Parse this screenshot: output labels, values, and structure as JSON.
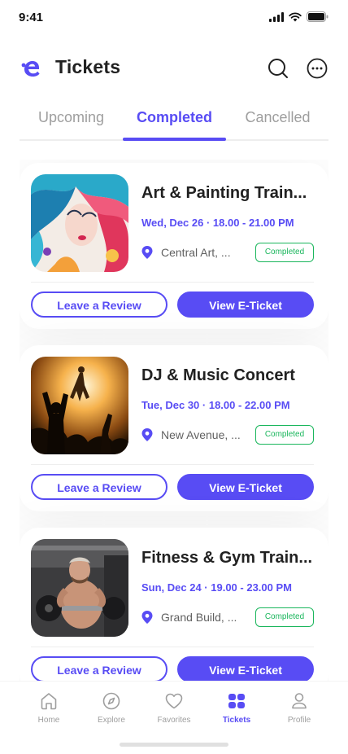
{
  "status_bar": {
    "time": "9:41"
  },
  "header": {
    "title": "Tickets"
  },
  "tabs": [
    {
      "label": "Upcoming",
      "active": false
    },
    {
      "label": "Completed",
      "active": true
    },
    {
      "label": "Cancelled",
      "active": false
    }
  ],
  "tickets": [
    {
      "title": "Art & Painting Train...",
      "date": "Wed, Dec 26 · 18.00 - 21.00 PM",
      "location": "Central Art, ...",
      "status": "Completed",
      "review_label": "Leave a Review",
      "ticket_label": "View E-Ticket",
      "image": "art-painting-image"
    },
    {
      "title": "DJ & Music Concert",
      "date": "Tue, Dec 30 · 18.00 - 22.00 PM",
      "location": "New Avenue, ...",
      "status": "Completed",
      "review_label": "Leave a Review",
      "ticket_label": "View E-Ticket",
      "image": "concert-image"
    },
    {
      "title": "Fitness & Gym Train...",
      "date": "Sun, Dec 24 · 19.00 - 23.00 PM",
      "location": "Grand Build, ...",
      "status": "Completed",
      "review_label": "Leave a Review",
      "ticket_label": "View E-Ticket",
      "image": "gym-image"
    }
  ],
  "bottom_nav": [
    {
      "label": "Home",
      "icon": "home-icon",
      "active": false
    },
    {
      "label": "Explore",
      "icon": "compass-icon",
      "active": false
    },
    {
      "label": "Favorites",
      "icon": "heart-icon",
      "active": false
    },
    {
      "label": "Tickets",
      "icon": "ticket-icon",
      "active": true
    },
    {
      "label": "Profile",
      "icon": "profile-icon",
      "active": false
    }
  ],
  "colors": {
    "primary": "#584CF4",
    "success": "#1AB65C",
    "muted": "#9E9E9E",
    "text": "#212121"
  }
}
